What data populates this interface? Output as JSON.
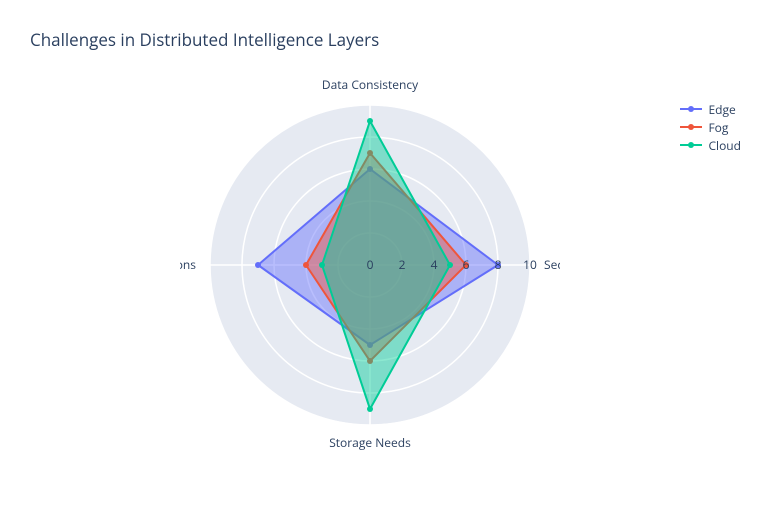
{
  "title": "Challenges in Distributed Intelligence Layers",
  "legend": {
    "items": [
      {
        "name": "Edge",
        "color": "#636efa"
      },
      {
        "name": "Fog",
        "color": "#EF553B"
      },
      {
        "name": "Cloud",
        "color": "#00cc96"
      }
    ]
  },
  "chart_data": {
    "type": "area",
    "categories": [
      "Security",
      "Data Consistency",
      "Bandwidth Limitations",
      "Storage Needs"
    ],
    "radial_ticks": [
      0,
      2,
      4,
      6,
      8,
      10
    ],
    "radial_range": [
      0,
      10
    ],
    "series": [
      {
        "name": "Edge",
        "color": "#636efa",
        "values": [
          8,
          6,
          7,
          5
        ]
      },
      {
        "name": "Fog",
        "color": "#EF553B",
        "values": [
          6,
          7,
          4,
          6
        ]
      },
      {
        "name": "Cloud",
        "color": "#00cc96",
        "values": [
          5,
          9,
          3,
          9
        ]
      }
    ],
    "title": "Challenges in Distributed Intelligence Layers",
    "xlabel": "",
    "ylabel": ""
  }
}
